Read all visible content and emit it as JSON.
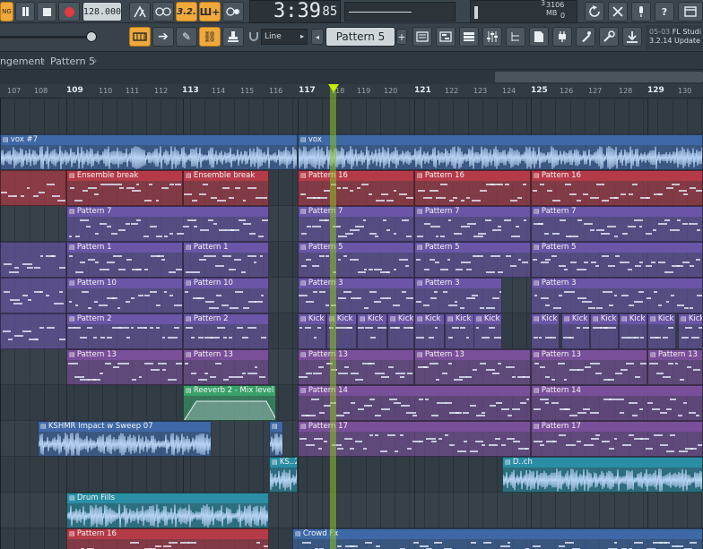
{
  "toolbar": {
    "mode_label": "NG",
    "tempo": "128.000",
    "time_main": "3:39",
    "time_sub": ":85",
    "meter_a": "3",
    "meter_b": "3106 MB",
    "meter_c": "0",
    "snap": "Line",
    "pattern": "Pattern 5",
    "news_date": "05-03",
    "news_app": "FL Studi",
    "news_update": "3.2.14 Update"
  },
  "breadcrumb": {
    "part1": "ngement",
    "part2": "Pattern 5"
  },
  "ruler": {
    "ticks": [
      "107",
      "108",
      "109",
      "110",
      "111",
      "112",
      "113",
      "114",
      "115",
      "116",
      "117",
      "118",
      "119",
      "120",
      "121",
      "122",
      "123",
      "124",
      "125",
      "126",
      "127",
      "128",
      "129",
      "130"
    ]
  },
  "tracks": [
    {
      "clips": [
        {
          "label": "vox #7",
          "kind": "audio"
        },
        {
          "label": "vox",
          "kind": "audio"
        }
      ]
    },
    {
      "clips": [
        {
          "label": "Ensemble break"
        },
        {
          "label": "Ensemble break"
        },
        {
          "label": "Pattern 16"
        },
        {
          "label": "Pattern 16"
        },
        {
          "label": "Pattern 16"
        }
      ]
    },
    {
      "clips": [
        {
          "label": "Pattern 7"
        },
        {
          "label": "Pattern 7"
        },
        {
          "label": "Pattern 7"
        },
        {
          "label": "Pattern 7"
        }
      ]
    },
    {
      "clips": [
        {
          "label": "Pattern 1"
        },
        {
          "label": "Pattern 1"
        },
        {
          "label": "Pattern 5"
        },
        {
          "label": "Pattern 5"
        },
        {
          "label": "Pattern 5"
        }
      ]
    },
    {
      "clips": [
        {
          "label": "Pattern 10"
        },
        {
          "label": "Pattern 10"
        },
        {
          "label": "Pattern 3"
        },
        {
          "label": "Pattern 3"
        },
        {
          "label": "Pattern 3"
        }
      ]
    },
    {
      "clips": [
        {
          "label": "Pattern 2"
        },
        {
          "label": "Pattern 2"
        },
        {
          "label": "Kick"
        },
        {
          "label": "Kick"
        },
        {
          "label": "Kick"
        },
        {
          "label": "Kick"
        },
        {
          "label": "Kick"
        },
        {
          "label": "Kick"
        },
        {
          "label": "Kick"
        },
        {
          "label": "Kick"
        },
        {
          "label": "Kick"
        },
        {
          "label": "Kick"
        },
        {
          "label": "Kick"
        },
        {
          "label": "Kick"
        },
        {
          "label": "Kick"
        }
      ]
    },
    {
      "clips": [
        {
          "label": "Pattern 13"
        },
        {
          "label": "Pattern 13"
        },
        {
          "label": "Pattern 13"
        },
        {
          "label": "Pattern 13"
        },
        {
          "label": "Pattern 13"
        },
        {
          "label": "Pattern 13"
        }
      ]
    },
    {
      "clips": [
        {
          "label": "Reeverb 2 - Mix level"
        },
        {
          "label": "Pattern 14"
        },
        {
          "label": "Pattern 14"
        }
      ]
    },
    {
      "clips": [
        {
          "label": "KSHMR Impact w Sweep 07"
        },
        {
          "label": ""
        },
        {
          "label": "Pattern 17"
        },
        {
          "label": "Pattern 17"
        }
      ]
    },
    {
      "clips": [
        {
          "label": "KS..2"
        },
        {
          "label": "D..ch"
        }
      ]
    },
    {
      "clips": [
        {
          "label": "Drum Fills"
        }
      ]
    },
    {
      "clips": [
        {
          "label": "Pattern 16"
        },
        {
          "label": "Crowd Fx"
        }
      ]
    }
  ],
  "colors": {
    "accent": "#f0a93a",
    "playhead": "#8bc328",
    "audio_clip": "#3e68a6",
    "red_clip": "#b53a48",
    "purple_clip": "#6a55a6",
    "violet_clip": "#7a4f9a",
    "teal_clip": "#2a8ea4",
    "green_auto": "#3aa06a"
  },
  "icons": [
    "play-icon",
    "stop-icon",
    "record-icon",
    "metronome-icon",
    "wait-icon",
    "countdown-icon",
    "step-icon",
    "loop-record-icon",
    "undo-icon",
    "mixer-icon",
    "cpu-icon",
    "help-icon",
    "playlist-icon",
    "piano-roll-icon",
    "channel-rack-icon",
    "browser-icon",
    "plugin-icon",
    "download-icon"
  ]
}
